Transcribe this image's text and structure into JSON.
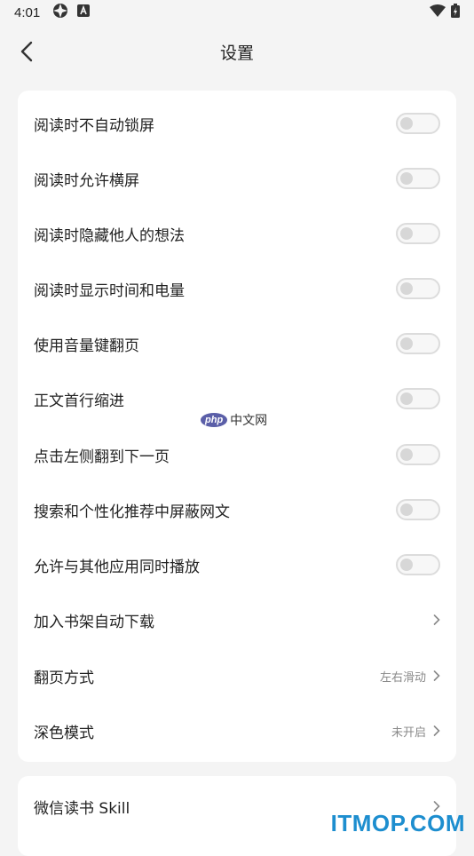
{
  "status_bar": {
    "time": "4:01"
  },
  "header": {
    "title": "设置"
  },
  "settings": [
    {
      "label": "阅读时不自动锁屏",
      "type": "toggle",
      "on": false
    },
    {
      "label": "阅读时允许横屏",
      "type": "toggle",
      "on": false
    },
    {
      "label": "阅读时隐藏他人的想法",
      "type": "toggle",
      "on": false
    },
    {
      "label": "阅读时显示时间和电量",
      "type": "toggle",
      "on": false
    },
    {
      "label": "使用音量键翻页",
      "type": "toggle",
      "on": false
    },
    {
      "label": "正文首行缩进",
      "type": "toggle",
      "on": false
    },
    {
      "label": "点击左侧翻到下一页",
      "type": "toggle",
      "on": false
    },
    {
      "label": "搜索和个性化推荐中屏蔽网文",
      "type": "toggle",
      "on": false
    },
    {
      "label": "允许与其他应用同时播放",
      "type": "toggle",
      "on": false
    },
    {
      "label": "加入书架自动下载",
      "type": "link",
      "value": ""
    },
    {
      "label": "翻页方式",
      "type": "link",
      "value": "左右滑动"
    },
    {
      "label": "深色模式",
      "type": "link",
      "value": "未开启"
    }
  ],
  "section2": [
    {
      "label": "微信读书 Skill",
      "type": "link",
      "value": ""
    }
  ],
  "watermarks": {
    "php_badge": "php",
    "php_text": "中文网",
    "site": "ITMOP.COM"
  }
}
